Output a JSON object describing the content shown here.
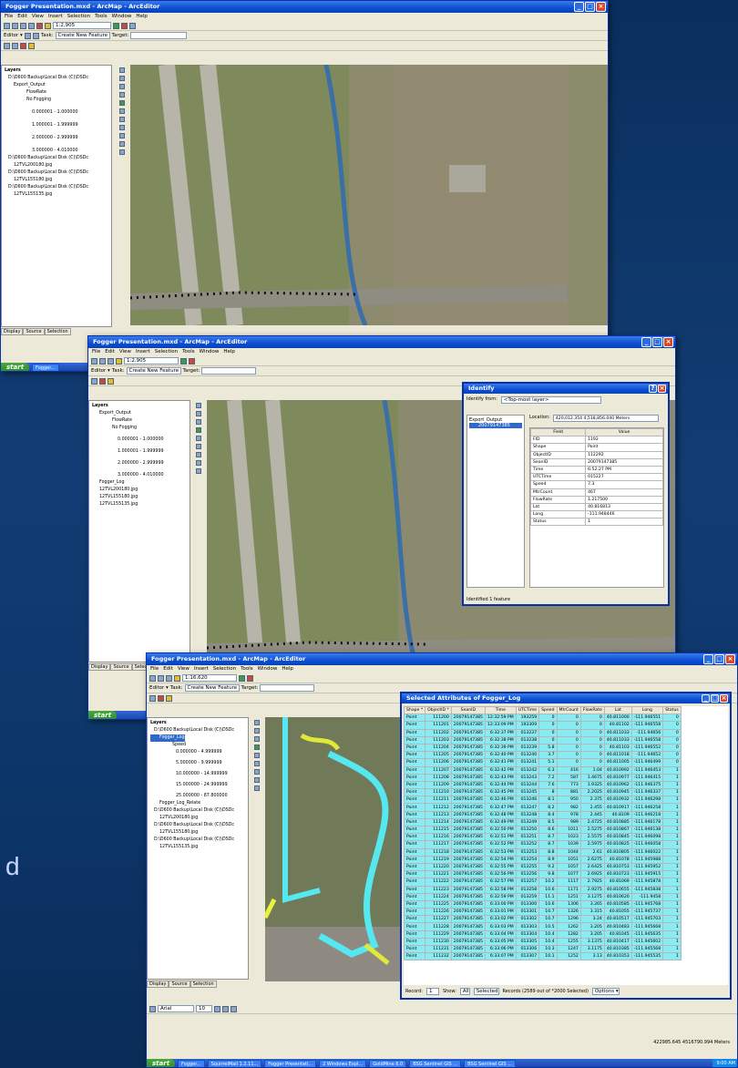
{
  "side_letter": "d",
  "w1": {
    "title": "Fogger Presentation.mxd - ArcMap - ArcEditor",
    "menu": [
      "File",
      "Edit",
      "View",
      "Insert",
      "Selection",
      "Tools",
      "Window",
      "Help"
    ],
    "scale": "1:2,905",
    "editor": "Editor ▾",
    "task_label": "Task:",
    "task_value": "Create New Feature",
    "target_label": "Target:",
    "toc": [
      "Layers",
      "D:\\D600 Backup\\Local Disk (C)\\DSDc",
      "Export_Output",
      "FlowRate",
      "No Fogging",
      "0.000001 - 1.000000",
      "1.000001 - 1.999999",
      "2.000000 - 2.999999",
      "3.000000 - 4.010000",
      "D:\\D600 Backup\\Local Disk (C)\\DSDc",
      "12TVL200180.jpg",
      "D:\\D600 Backup\\Local Disk (C)\\DSDc",
      "12TVL155180.jpg",
      "D:\\D600 Backup\\Local Disk (C)\\DSDc",
      "12TVL155135.jpg"
    ],
    "tabs": [
      "Display",
      "Source",
      "Selection"
    ],
    "task_btn": "Fogger...",
    "start": "start"
  },
  "w2": {
    "title": "Fogger Presentation.mxd - ArcMap - ArcEditor",
    "scale": "1:2,905",
    "toc": [
      "Layers",
      "Export_Output",
      "FlowRate",
      "No Fogging",
      "0.000001 - 1.000000",
      "1.000001 - 1.999999",
      "2.000000 - 2.999999",
      "3.000000 - 4.010000",
      "Fogger_Log",
      "12TVL200180.jpg",
      "12TVL155180.jpg",
      "12TVL155135.jpg"
    ],
    "tabs": [
      "Display",
      "Source",
      "Selection"
    ],
    "start": "start",
    "identify": {
      "title": "Identify",
      "from_label": "Identify from:",
      "from_value": "<Top-most layer>",
      "layer": "Export_Output",
      "feature": "20079147385",
      "location_label": "Location:",
      "location": "420,012.354  4,518,856.040 Meters",
      "field_h": "Field",
      "value_h": "Value",
      "rows": [
        [
          "FID",
          "1192"
        ],
        [
          "Shape",
          "Point"
        ],
        [
          "ObjectID",
          "112292"
        ],
        [
          "SeanID",
          "20079147385"
        ],
        [
          "Time",
          "6:52:27 PM"
        ],
        [
          "UTCTime",
          "015227"
        ],
        [
          "Speed",
          "7.3"
        ],
        [
          "MtrCount",
          "467"
        ],
        [
          "FlowRate",
          "1.217500"
        ],
        [
          "Lat",
          "40.816813"
        ],
        [
          "Long",
          "-111.948446"
        ],
        [
          "Status",
          "1"
        ]
      ],
      "footer": "Identified 1 feature"
    }
  },
  "w3": {
    "title": "Fogger Presentation.mxd - ArcMap - ArcEditor",
    "scale": "1:16,620",
    "toc": [
      "Layers",
      "D:\\D600 Backup\\Local Disk (C)\\DSDc",
      "Fogger_Log",
      "Speed",
      "0.000000 - 4.999999",
      "5.000000 - 9.999999",
      "10.000000 - 14.999999",
      "15.000000 - 24.999999",
      "25.000000 - 87.800000",
      "Fogger_Log_Relate",
      "D:\\D600 Backup\\Local Disk (C)\\DSDc",
      "12TVL200180.jpg",
      "D:\\D600 Backup\\Local Disk (C)\\DSDc",
      "12TVL155180.jpg",
      "D:\\D600 Backup\\Local Disk (C)\\DSDc",
      "12TVL155135.jpg"
    ],
    "tabs": [
      "Display",
      "Source",
      "Selection"
    ],
    "coords": "422985.645  4516790.994 Meters",
    "font": "Arial",
    "fontsize": "10",
    "taskbar": [
      "Fogger...",
      "SquirrelMail 1.2.11...",
      "Fogger Presentati...",
      "2 Windows Expl...",
      "GoldMine 6.0",
      "BSG Sentinel GIS ...",
      "BSG Sentinel GIS ..."
    ],
    "clock": "9:00 AM",
    "start": "start",
    "attr": {
      "title": "Selected Attributes of Fogger_Log",
      "headers": [
        "Shape *",
        "ObjectID *",
        "SeanID",
        "Time",
        "UTCTime",
        "Speed",
        "MtrCount",
        "FlowRate",
        "Lat",
        "Long",
        "Status"
      ],
      "rows": [
        [
          "Point",
          "111200",
          "20079147385",
          "12:32:59 PM",
          "193259",
          "0",
          "0",
          "0",
          "40.811000",
          "-111.946551",
          "0"
        ],
        [
          "Point",
          "111201",
          "20079147385",
          "12:33:09 PM",
          "193309",
          "0",
          "0",
          "0",
          "40.81102",
          "-111.946558",
          "0"
        ],
        [
          "Point",
          "111202",
          "20079147385",
          "6:32:37 PM",
          "013237",
          "0",
          "0",
          "0",
          "40.811033",
          "-111.94656",
          "0"
        ],
        [
          "Point",
          "111203",
          "20079147385",
          "6:32:38 PM",
          "013238",
          "0",
          "0",
          "0",
          "40.811033",
          "-111.946558",
          "0"
        ],
        [
          "Point",
          "111204",
          "20079147385",
          "6:32:39 PM",
          "013239",
          "5.8",
          "0",
          "0",
          "40.81103",
          "-111.946552",
          "0"
        ],
        [
          "Point",
          "111205",
          "20079147385",
          "6:32:40 PM",
          "013240",
          "3.7",
          "0",
          "0",
          "40.811018",
          "-111.94652",
          "0"
        ],
        [
          "Point",
          "111206",
          "20079147385",
          "6:32:41 PM",
          "013241",
          "5.1",
          "0",
          "0",
          "40.811005",
          "-111.946499",
          "0"
        ],
        [
          "Point",
          "111207",
          "20079147385",
          "6:32:42 PM",
          "013242",
          "6.3",
          "416",
          "1.04",
          "40.810992",
          "-111.946453",
          "1"
        ],
        [
          "Point",
          "111208",
          "20079147385",
          "6:32:43 PM",
          "013243",
          "7.2",
          "587",
          "1.4675",
          "40.810977",
          "-111.946415",
          "1"
        ],
        [
          "Point",
          "111209",
          "20079147385",
          "6:32:44 PM",
          "013244",
          "7.6",
          "773",
          "1.9325",
          "40.810962",
          "-111.946375",
          "1"
        ],
        [
          "Point",
          "111210",
          "20079147385",
          "6:32:45 PM",
          "013245",
          "8",
          "881",
          "2.2025",
          "40.810945",
          "-111.946337",
          "1"
        ],
        [
          "Point",
          "111211",
          "20079147385",
          "6:32:46 PM",
          "013246",
          "8.1",
          "950",
          "2.375",
          "40.810932",
          "-111.946298",
          "1"
        ],
        [
          "Point",
          "111212",
          "20079147385",
          "6:32:47 PM",
          "013247",
          "8.2",
          "982",
          "2.455",
          "40.810917",
          "-111.946258",
          "1"
        ],
        [
          "Point",
          "111213",
          "20079147385",
          "6:32:48 PM",
          "013248",
          "8.4",
          "978",
          "2.445",
          "40.8109",
          "-111.946218",
          "1"
        ],
        [
          "Point",
          "111214",
          "20079147385",
          "6:32:49 PM",
          "013249",
          "8.5",
          "989",
          "2.4725",
          "40.810885",
          "-111.946178",
          "1"
        ],
        [
          "Point",
          "111215",
          "20079147385",
          "6:32:50 PM",
          "013250",
          "8.6",
          "1011",
          "2.5275",
          "40.810867",
          "-111.946138",
          "1"
        ],
        [
          "Point",
          "111216",
          "20079147385",
          "6:32:51 PM",
          "013251",
          "8.7",
          "1023",
          "2.5575",
          "40.810845",
          "-111.946098",
          "1"
        ],
        [
          "Point",
          "111217",
          "20079147385",
          "6:32:52 PM",
          "013252",
          "8.7",
          "1039",
          "2.5975",
          "40.810825",
          "-111.946058",
          "1"
        ],
        [
          "Point",
          "111218",
          "20079147385",
          "6:32:53 PM",
          "013253",
          "8.8",
          "1044",
          "2.61",
          "40.810805",
          "-111.946022",
          "1"
        ],
        [
          "Point",
          "111219",
          "20079147385",
          "6:32:54 PM",
          "013254",
          "8.9",
          "1051",
          "2.6275",
          "40.81078",
          "-111.945988",
          "1"
        ],
        [
          "Point",
          "111220",
          "20079147385",
          "6:32:55 PM",
          "013255",
          "9.2",
          "1057",
          "2.6425",
          "40.810753",
          "-111.945952",
          "1"
        ],
        [
          "Point",
          "111221",
          "20079147385",
          "6:32:56 PM",
          "013256",
          "9.8",
          "1077",
          "2.6925",
          "40.810723",
          "-111.945915",
          "1"
        ],
        [
          "Point",
          "111222",
          "20079147385",
          "6:32:57 PM",
          "013257",
          "10.2",
          "1117",
          "2.7925",
          "40.81069",
          "-111.945878",
          "1"
        ],
        [
          "Point",
          "111223",
          "20079147385",
          "6:32:58 PM",
          "013258",
          "10.6",
          "1171",
          "2.9275",
          "40.810655",
          "-111.945838",
          "1"
        ],
        [
          "Point",
          "111224",
          "20079147385",
          "6:32:59 PM",
          "013259",
          "11.1",
          "1251",
          "3.1275",
          "40.810620",
          "-111.9458",
          "1"
        ],
        [
          "Point",
          "111225",
          "20079147385",
          "6:33:00 PM",
          "013300",
          "10.6",
          "1306",
          "3.265",
          "40.810585",
          "-111.945768",
          "1"
        ],
        [
          "Point",
          "111226",
          "20079147385",
          "6:33:01 PM",
          "013301",
          "10.7",
          "1326",
          "3.315",
          "40.81055",
          "-111.945737",
          "1"
        ],
        [
          "Point",
          "111227",
          "20079147385",
          "6:33:02 PM",
          "013302",
          "10.7",
          "1296",
          "3.24",
          "40.810517",
          "-111.945703",
          "1"
        ],
        [
          "Point",
          "111228",
          "20079147385",
          "6:33:03 PM",
          "013303",
          "10.5",
          "1262",
          "3.205",
          "40.810483",
          "-111.945668",
          "1"
        ],
        [
          "Point",
          "111229",
          "20079147385",
          "6:33:04 PM",
          "013304",
          "10.4",
          "1282",
          "3.205",
          "40.81045",
          "-111.945635",
          "1"
        ],
        [
          "Point",
          "111230",
          "20079147385",
          "6:33:05 PM",
          "013305",
          "10.4",
          "1255",
          "3.1375",
          "40.810417",
          "-111.945602",
          "1"
        ],
        [
          "Point",
          "111231",
          "20079147385",
          "6:33:06 PM",
          "013306",
          "10.3",
          "1247",
          "3.1175",
          "40.810385",
          "-111.945568",
          "1"
        ],
        [
          "Point",
          "111232",
          "20079147385",
          "6:33:07 PM",
          "013307",
          "10.1",
          "1252",
          "3.13",
          "40.810353",
          "-111.945535",
          "1"
        ]
      ],
      "record_label": "Record:",
      "record_num": "1",
      "show_label": "Show:",
      "show_all": "All",
      "show_sel": "Selected",
      "records": "Records (2589 out of *2000 Selected)",
      "options": "Options ▾"
    }
  }
}
